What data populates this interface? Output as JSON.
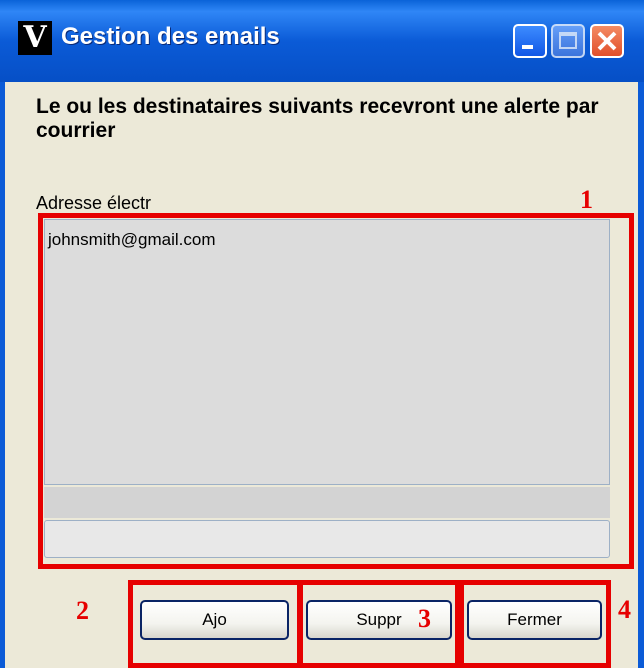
{
  "window": {
    "title": "Gestion des emails",
    "app_icon_glyph": "V"
  },
  "message": "Le ou les destinataires suivants recevront une alerte par courrier",
  "list": {
    "column_label": "Adresse électr",
    "items": [
      "johnsmith@gmail.com"
    ]
  },
  "input": {
    "value": ""
  },
  "buttons": {
    "add": "Ajo",
    "delete": "Suppr",
    "close": "Fermer"
  },
  "annotations": [
    "1",
    "2",
    "3",
    "4"
  ],
  "colors": {
    "title_bar": "#0b5bd7",
    "annotation": "#e60000",
    "dialog_bg": "#ece9d8"
  }
}
